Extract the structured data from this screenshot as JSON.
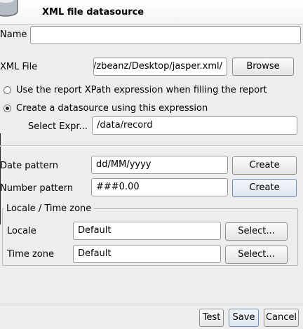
{
  "dialog": {
    "title": "XML file datasource"
  },
  "name": {
    "label": "Name",
    "value": ""
  },
  "xml_file": {
    "label": "XML File",
    "value": "/home/zbeanz/Desktop/jasper.xml",
    "browse_label": "Browse"
  },
  "options": {
    "report_xpath": {
      "label": "Use the report XPath expression when filling the report",
      "checked": false
    },
    "create_datasource": {
      "label": "Create a datasource using this expression",
      "checked": true
    }
  },
  "select_expr": {
    "label": "Select Expr...",
    "value": "/data/record"
  },
  "date_pattern": {
    "label": "Date pattern",
    "value": "dd/MM/yyyy",
    "create_label": "Create"
  },
  "number_pattern": {
    "label": "Number pattern",
    "value": "###0.00",
    "create_label": "Create"
  },
  "locale_group": {
    "legend": "Locale / Time zone",
    "locale": {
      "label": "Locale",
      "value": "Default",
      "select_label": "Select..."
    },
    "timezone": {
      "label": "Time zone",
      "value": "Default",
      "select_label": "Select..."
    }
  },
  "footer": {
    "test_label": "Test",
    "save_label": "Save",
    "cancel_label": "Cancel"
  },
  "icons": {
    "datasource": "database-icon"
  }
}
